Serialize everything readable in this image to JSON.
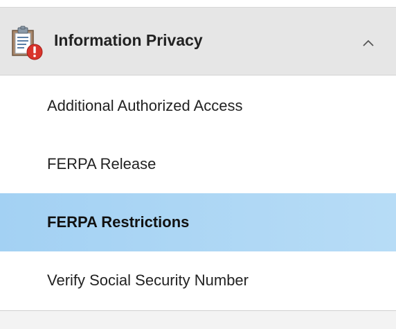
{
  "section": {
    "title": "Information Privacy",
    "icon": "clipboard-alert-icon",
    "expanded": true,
    "toggle_icon": "chevron-up-icon",
    "header_bg": "#e6e6e6"
  },
  "nav": {
    "items": [
      {
        "label": "Additional Authorized Access",
        "active": false
      },
      {
        "label": "FERPA Release",
        "active": false
      },
      {
        "label": "FERPA Restrictions",
        "active": true
      },
      {
        "label": "Verify Social Security Number",
        "active": false
      }
    ],
    "active_bg": "#a3d1f3"
  }
}
